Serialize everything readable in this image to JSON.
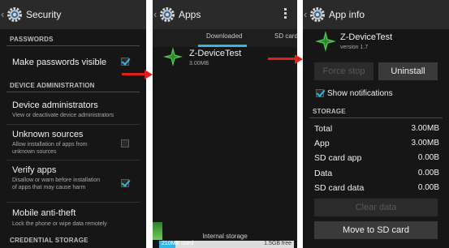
{
  "colors": {
    "accent": "#33b5e5",
    "arrow": "#e0201b",
    "background": "#161616",
    "actionbar": "#2a2a2a"
  },
  "security": {
    "title": "Security",
    "back_glyph": "‹",
    "sections": {
      "passwords": "PASSWORDS",
      "device_admin": "DEVICE ADMINISTRATION",
      "credential_storage": "CREDENTIAL STORAGE"
    },
    "items": [
      {
        "title": "Make passwords visible",
        "subtitle": "",
        "checked": true
      },
      {
        "title": "Device administrators",
        "subtitle": "View or deactivate device administrators",
        "checked": null
      },
      {
        "title": "Unknown sources",
        "subtitle": "Allow installation of apps from unknown sources",
        "checked": false
      },
      {
        "title": "Verify apps",
        "subtitle": "Disallow or warn before installation of apps that may cause harm",
        "checked": true
      },
      {
        "title": "Mobile anti-theft",
        "subtitle": "Lock the phone or wipe data remotely",
        "checked": null
      }
    ]
  },
  "apps": {
    "title": "Apps",
    "tabs": [
      "Downloaded",
      "SD card"
    ],
    "app": {
      "name": "Z-DeviceTest",
      "size": "3.00MB"
    },
    "storage": {
      "label": "Internal storage",
      "used": "210MB used",
      "free": "1.5GB free",
      "used_fraction": 0.12
    }
  },
  "app_info": {
    "title": "App info",
    "app": {
      "name": "Z-DeviceTest",
      "version": "version 1.7"
    },
    "buttons": {
      "force_stop": "Force stop",
      "uninstall": "Uninstall",
      "clear_data": "Clear data",
      "move_to_sd": "Move to SD card"
    },
    "show_notifications": {
      "label": "Show notifications",
      "checked": true
    },
    "storage_header": "STORAGE",
    "rows": [
      {
        "label": "Total",
        "value": "3.00MB"
      },
      {
        "label": "App",
        "value": "3.00MB"
      },
      {
        "label": "SD card app",
        "value": "0.00B"
      },
      {
        "label": "Data",
        "value": "0.00B"
      },
      {
        "label": "SD card data",
        "value": "0.00B"
      }
    ]
  },
  "icons": {
    "settings": "gear-icon",
    "app": "green-star-icon",
    "overflow": "overflow-menu-icon",
    "arrow": "red-arrow"
  }
}
